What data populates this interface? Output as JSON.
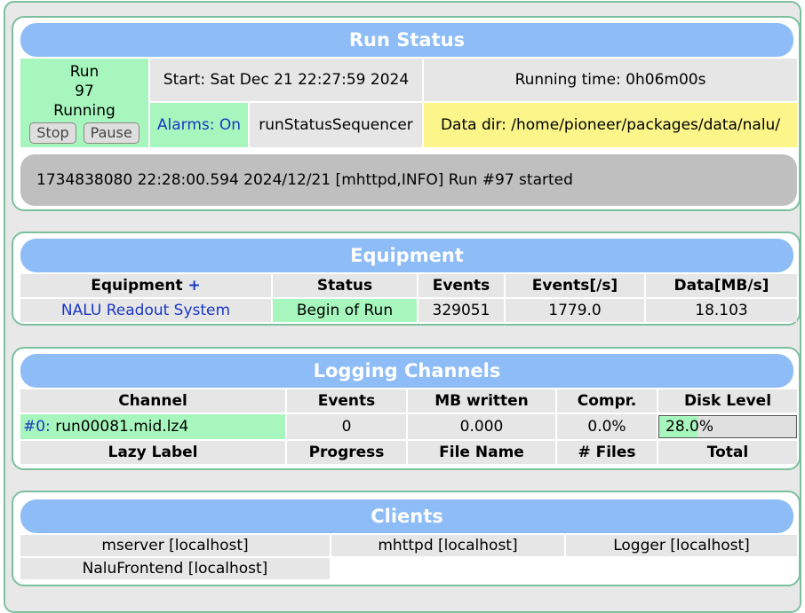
{
  "run_status": {
    "title": "Run Status",
    "run_label": "Run",
    "run_number": "97",
    "state": "Running",
    "stop_label": "Stop",
    "pause_label": "Pause",
    "start_text": "Start: Sat Dec 21 22:27:59 2024",
    "running_time": "Running time: 0h06m00s",
    "alarms_text": "Alarms: On",
    "sequencer": "runStatusSequencer",
    "data_dir": "Data dir: /home/pioneer/packages/data/nalu/",
    "message": "1734838080 22:28:00.594 2024/12/21 [mhttpd,INFO] Run #97 started"
  },
  "equipment": {
    "title": "Equipment",
    "headers": [
      "Equipment",
      "Status",
      "Events",
      "Events[/s]",
      "Data[MB/s]"
    ],
    "plus": "+",
    "rows": [
      {
        "name": "NALU Readout System",
        "status": "Begin of Run",
        "events": "329051",
        "rate": "1779.0",
        "data": "18.103"
      }
    ]
  },
  "logging": {
    "title": "Logging Channels",
    "headers": [
      "Channel",
      "Events",
      "MB written",
      "Compr.",
      "Disk Level"
    ],
    "channel_id": "#0:",
    "channel_file": "run00081.mid.lz4",
    "events": "0",
    "mb_written": "0.000",
    "compr": "0.0%",
    "disk_level_text": "28.0%",
    "disk_level_fraction": 0.28,
    "lazy_headers": [
      "Lazy Label",
      "Progress",
      "File Name",
      "# Files",
      "Total"
    ]
  },
  "clients": {
    "title": "Clients",
    "items": [
      "mserver [localhost]",
      "mhttpd [localhost]",
      "Logger [localhost]",
      "NaluFrontend [localhost]"
    ]
  },
  "colors": {
    "header_blue": "#8dbcf6",
    "status_green": "#a6f6bd",
    "data_dir_yellow": "#fbf58a",
    "panel_border": "#7cc09e"
  }
}
